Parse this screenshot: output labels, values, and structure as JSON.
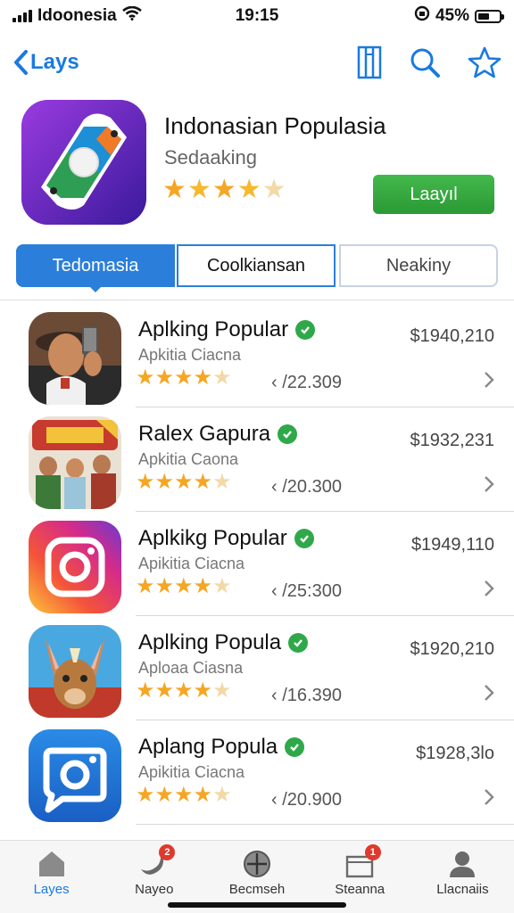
{
  "status_bar": {
    "carrier": "Idoonesia",
    "time": "19:15",
    "battery": "45%"
  },
  "nav": {
    "back_label": "Lays"
  },
  "hero": {
    "title": "Indonasian Populasia",
    "subtitle": "Sedaaking",
    "rating": 4,
    "get_label": "Laayıl"
  },
  "segments": [
    "Tedomasia",
    "Coolkiansan",
    "Neakiny"
  ],
  "apps": [
    {
      "name": "Aplking Popular",
      "developer": "Apkitia Ciacna",
      "count": "/22.309",
      "price": "$1940,210",
      "icon": "selfie-photo-icon"
    },
    {
      "name": "Ralex Gapura",
      "developer": "Apkitia Caona",
      "count": "/20.300",
      "price": "$1932,231",
      "icon": "group-photo-icon"
    },
    {
      "name": "Aplkikg Popular",
      "developer": "Apikitia Ciacna",
      "count": "/25:300",
      "price": "$1949,110",
      "icon": "camera-gradient-icon"
    },
    {
      "name": "Aplking Popula",
      "developer": "Aploaa Ciasna",
      "count": "/16.390",
      "price": "$1920,210",
      "icon": "kangaroo-icon"
    },
    {
      "name": "Aplang Popula",
      "developer": "Apikitia Ciacna",
      "count": "/20.900",
      "price": "$1928,3lo",
      "icon": "chat-camera-icon"
    }
  ],
  "tabs": [
    {
      "label": "Layes",
      "active": true,
      "badge": ""
    },
    {
      "label": "Nayeo",
      "active": false,
      "badge": "2"
    },
    {
      "label": "Becmseh",
      "active": false,
      "badge": ""
    },
    {
      "label": "Steanna",
      "active": false,
      "badge": "1"
    },
    {
      "label": "Llacnaiis",
      "active": false,
      "badge": ""
    }
  ]
}
